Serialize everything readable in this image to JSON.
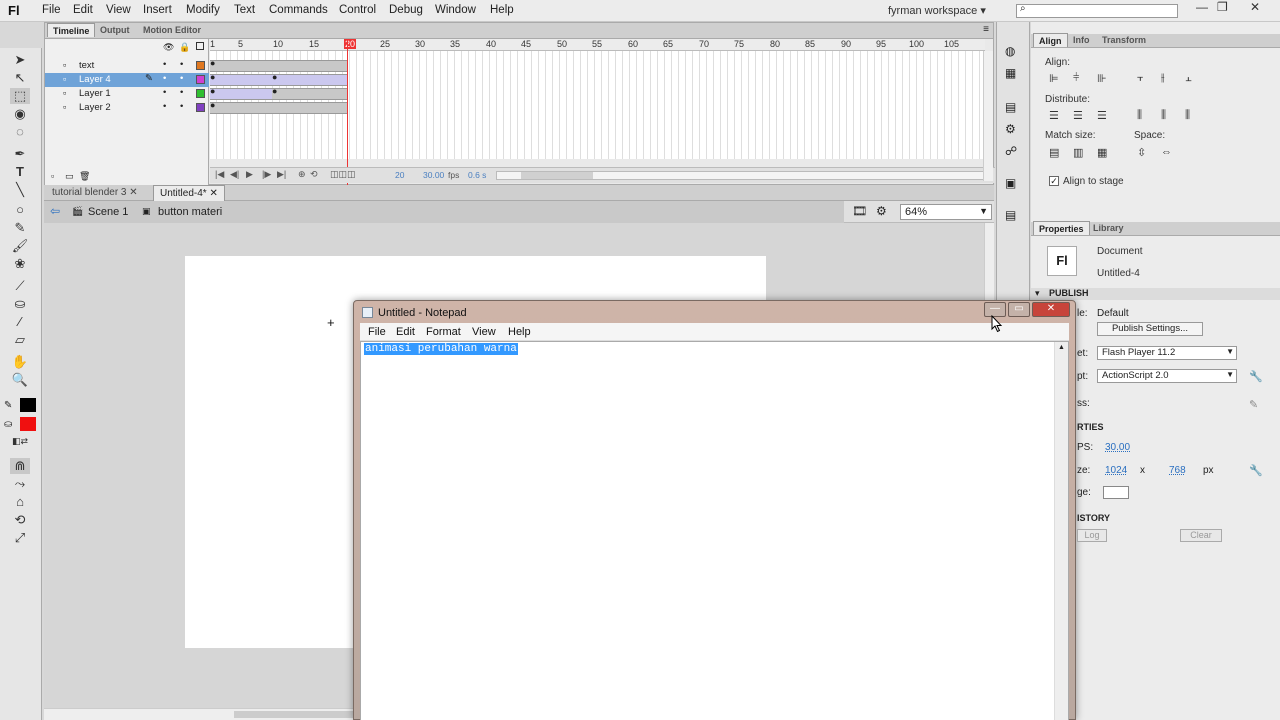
{
  "app": {
    "logo": "Fl",
    "workspace": "fyrman workspace"
  },
  "menu": [
    "File",
    "Edit",
    "View",
    "Insert",
    "Modify",
    "Text",
    "Commands",
    "Control",
    "Debug",
    "Window",
    "Help"
  ],
  "panel_tabs": [
    "Timeline",
    "Output",
    "Motion Editor"
  ],
  "layers": [
    {
      "name": "text",
      "color": "#e07820"
    },
    {
      "name": "Layer 4",
      "color": "#d040d0",
      "selected": true
    },
    {
      "name": "Layer 1",
      "color": "#30c030"
    },
    {
      "name": "Layer 2",
      "color": "#8040c0"
    }
  ],
  "frame_numbers": [
    "1",
    "5",
    "10",
    "15",
    "20",
    "25",
    "30",
    "35",
    "40",
    "45",
    "50",
    "55",
    "60",
    "65",
    "70",
    "75",
    "80",
    "85",
    "90",
    "95",
    "100",
    "105"
  ],
  "timeline_footer": {
    "frame": "20",
    "fps": "30.00",
    "fps_unit": "fps",
    "time": "0.6 s"
  },
  "doc_tabs": [
    "tutorial blender 3",
    "Untitled-4*"
  ],
  "scene": {
    "name": "Scene 1",
    "symbol": "button materi",
    "zoom": "64%"
  },
  "right_tabs_top": [
    "Align",
    "Info",
    "Transform"
  ],
  "align": {
    "align": "Align:",
    "distribute": "Distribute:",
    "match_size": "Match size:",
    "space": "Space:",
    "align_to_stage": "Align to stage"
  },
  "right_tabs_bottom": [
    "Properties",
    "Library"
  ],
  "properties": {
    "logo": "Fl",
    "type": "Document",
    "doc_name": "Untitled-4",
    "publish_header": "PUBLISH",
    "profile_label": "le:",
    "profile_value": "Default",
    "publish_settings": "Publish Settings...",
    "player_label": "et:",
    "player_value": "Flash Player 11.2",
    "script_label": "pt:",
    "script_value": "ActionScript 2.0",
    "class_label": "ss:",
    "props_header": "RTIES",
    "fps_label": "PS:",
    "fps_value": "30.00",
    "size_label": "ze:",
    "width": "1024",
    "x": "x",
    "height": "768",
    "unit": "px",
    "stage_label": "ge:",
    "history_header": "ISTORY",
    "log_btn": "Log",
    "clear_btn": "Clear"
  },
  "notepad": {
    "title": "Untitled - Notepad",
    "menu": [
      "File",
      "Edit",
      "Format",
      "View",
      "Help"
    ],
    "text": "animasi perubahan warna"
  }
}
